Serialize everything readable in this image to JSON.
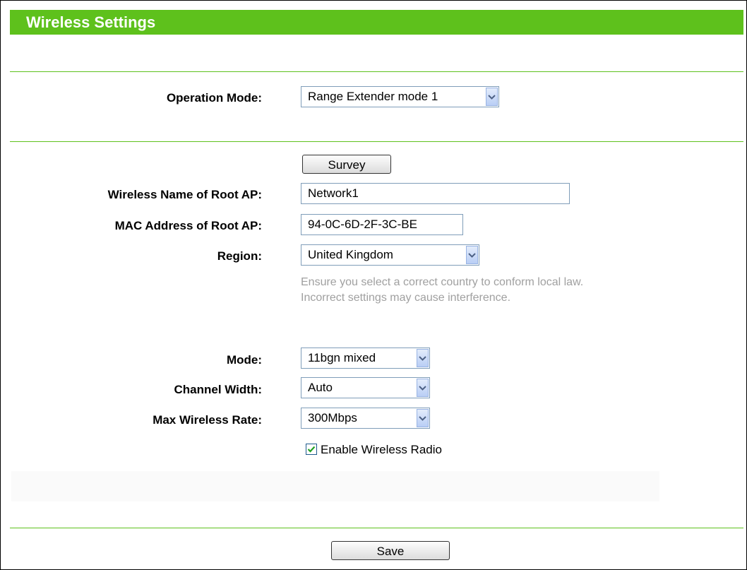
{
  "header": {
    "title": "Wireless Settings"
  },
  "form": {
    "operation_mode": {
      "label": "Operation Mode:",
      "value": "Range Extender mode 1"
    },
    "survey_button": "Survey",
    "root_ap_name": {
      "label": "Wireless Name of Root AP:",
      "value": "Network1"
    },
    "root_ap_mac": {
      "label": "MAC Address of Root AP:",
      "value": "94-0C-6D-2F-3C-BE"
    },
    "region": {
      "label": "Region:",
      "value": "United Kingdom"
    },
    "region_hint_line1": "Ensure you select a correct country to conform local law.",
    "region_hint_line2": "Incorrect settings may cause interference.",
    "mode": {
      "label": "Mode:",
      "value": "11bgn mixed"
    },
    "channel_width": {
      "label": "Channel Width:",
      "value": "Auto"
    },
    "max_rate": {
      "label": "Max Wireless Rate:",
      "value": "300Mbps"
    },
    "enable_radio": {
      "label": "Enable Wireless Radio",
      "checked": true
    }
  },
  "footer": {
    "save_button": "Save"
  },
  "colors": {
    "accent": "#5ec11c",
    "hint_text": "#a0a0a0"
  },
  "icons": [
    "chevron-down-icon",
    "check-icon"
  ]
}
